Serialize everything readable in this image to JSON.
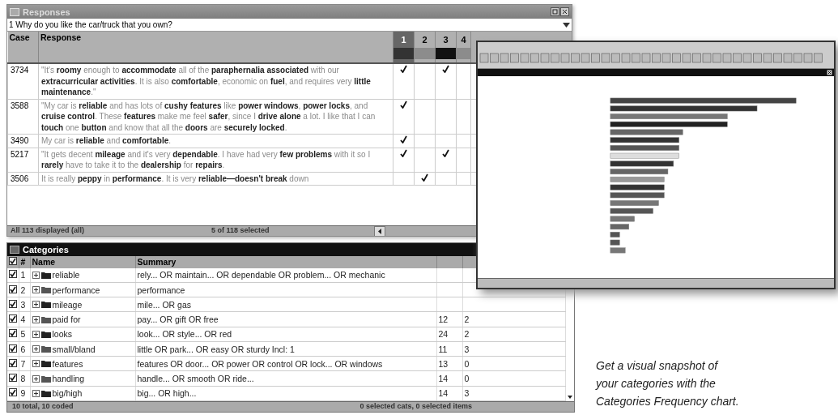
{
  "responses": {
    "title": "Responses",
    "question": "1 Why do you like the car/truck that you own?",
    "columns": [
      "Case",
      "Response"
    ],
    "code_columns": [
      {
        "label": "1",
        "selected": true,
        "color": "#333333"
      },
      {
        "label": "2",
        "selected": false,
        "color": "#8c8c8c"
      },
      {
        "label": "3",
        "selected": false,
        "color": "#111111"
      },
      {
        "label": "4",
        "selected": false,
        "color": "#8c8c8c"
      }
    ],
    "rows": [
      {
        "case": "3734",
        "response": "\"It's **roomy** enough to **accommodate** all of the **paraphernalia associated** with our **extracurricular activities**. It is also **comfortable**, economic on **fuel**, and requires very **little maintenance**.\"",
        "checks": [
          true,
          false,
          true,
          false
        ]
      },
      {
        "case": "3588",
        "response": "\"My car is **reliable** and has lots of **cushy features** like **power windows**, **power locks**, and **cruise control**. These **features** make me feel **safer**, since I **drive alone** a lot. I like that I can **touch** one **button** and know that all the **doors** are **securely locked**.",
        "checks": [
          true,
          false,
          false,
          false
        ]
      },
      {
        "case": "3490",
        "response": "My car is **reliable** and **comfortable**.",
        "checks": [
          true,
          false,
          false,
          false
        ]
      },
      {
        "case": "5217",
        "response": "\"It gets decent **mileage** and it's very **dependable**. I have had very **few problems** with it so I **rarely** have to take it to the **dealership** for **repairs**.",
        "checks": [
          true,
          false,
          true,
          false
        ]
      },
      {
        "case": "3506",
        "response": "It is really **peppy** in **performance**. It is very **reliable—doesn't break** down",
        "checks": [
          false,
          true,
          false,
          false
        ]
      }
    ],
    "status": [
      "All 113 displayed (all)",
      "5 of 118 selected"
    ]
  },
  "categories": {
    "title": "Categories",
    "columns": [
      "#",
      "Name",
      "Summary"
    ],
    "rows": [
      {
        "checked": true,
        "number": "1",
        "name": "reliable",
        "summary": "rely... OR maintain... OR dependable OR problem... OR mechanic"
      },
      {
        "checked": true,
        "number": "2",
        "name": "performance",
        "summary": "performance"
      },
      {
        "checked": true,
        "number": "3",
        "name": "mileage",
        "summary": "mile... OR gas"
      },
      {
        "checked": true,
        "number": "4",
        "name": "paid for",
        "summary": "pay... OR gift OR free",
        "column_4": "12",
        "column_5": "2"
      },
      {
        "checked": true,
        "number": "5",
        "name": "looks",
        "summary": "look... OR style... OR red",
        "column_4": "24",
        "column_5": "2"
      },
      {
        "checked": true,
        "number": "6",
        "name": "small/bland",
        "summary": "little OR park... OR easy OR sturdy  Incl: 1",
        "column_4": "11",
        "column_5": "3"
      },
      {
        "checked": true,
        "number": "7",
        "name": "features",
        "summary": "features OR door... OR power OR control OR lock... OR windows",
        "column_4": "13",
        "column_5": "0"
      },
      {
        "checked": true,
        "number": "8",
        "name": "handling",
        "summary": "handle... OR smooth OR ride...",
        "column_4": "14",
        "column_5": "0"
      },
      {
        "checked": true,
        "number": "9",
        "name": "big/high",
        "summary": "big... OR high...",
        "column_4": "14",
        "column_5": "3"
      }
    ],
    "status": [
      "10 total, 10 coded",
      "0 selected cats, 0 selected items"
    ]
  },
  "caption": "Get a visual snapshot of\nyour categories with the\nCategories Frequency chart."
}
